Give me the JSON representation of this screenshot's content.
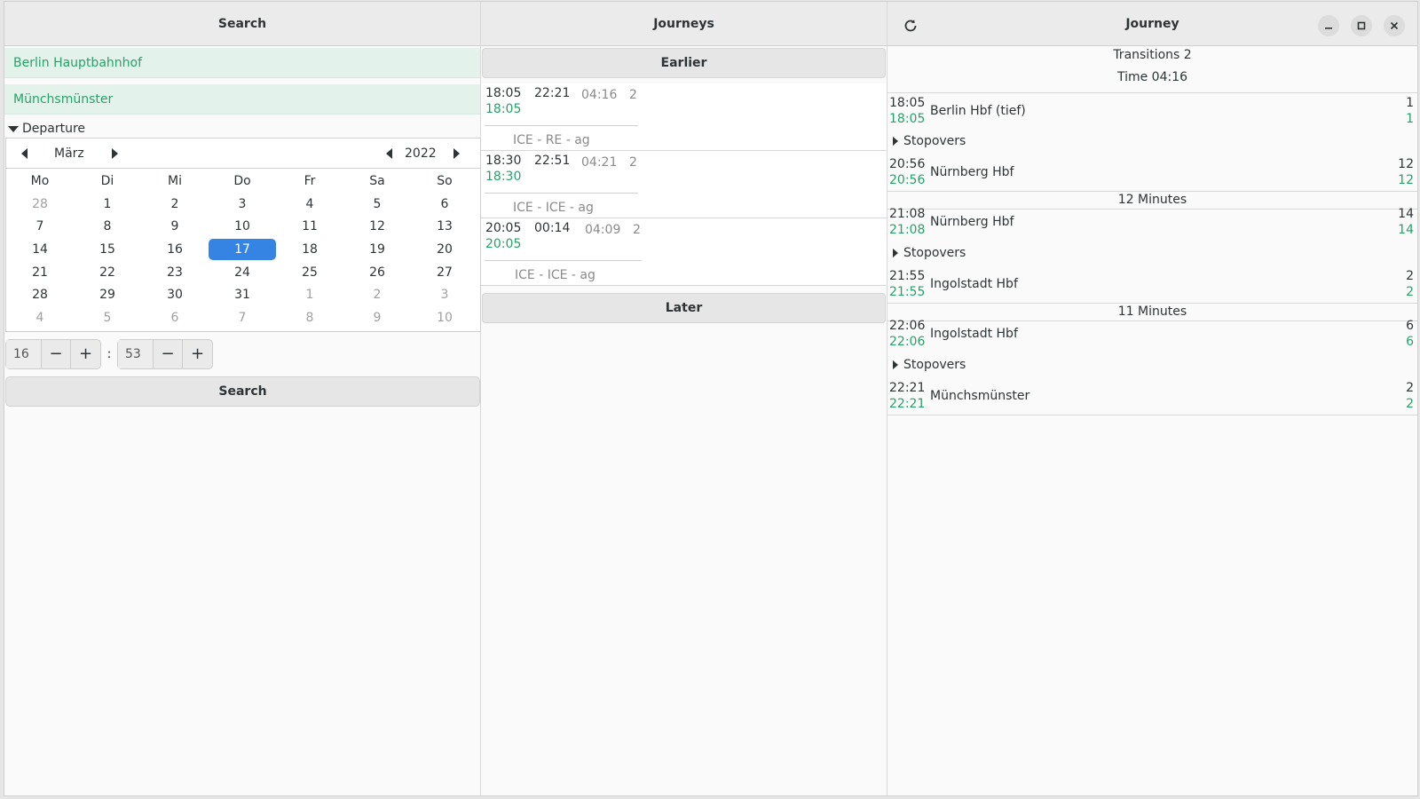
{
  "search": {
    "title": "Search",
    "from": "Berlin Hauptbahnhof",
    "to": "Münchsmünster",
    "mode": "Departure",
    "calendar": {
      "month": "März",
      "year": "2022",
      "weekdays": [
        "Mo",
        "Di",
        "Mi",
        "Do",
        "Fr",
        "Sa",
        "So"
      ],
      "weeks": [
        [
          "28",
          "1",
          "2",
          "3",
          "4",
          "5",
          "6"
        ],
        [
          "7",
          "8",
          "9",
          "10",
          "11",
          "12",
          "13"
        ],
        [
          "14",
          "15",
          "16",
          "17",
          "18",
          "19",
          "20"
        ],
        [
          "21",
          "22",
          "23",
          "24",
          "25",
          "26",
          "27"
        ],
        [
          "28",
          "29",
          "30",
          "31",
          "1",
          "2",
          "3"
        ],
        [
          "4",
          "5",
          "6",
          "7",
          "8",
          "9",
          "10"
        ]
      ],
      "selected_day": "17"
    },
    "hour": "16",
    "minute": "53",
    "colon": ":",
    "minus": "−",
    "plus": "+",
    "button": "Search"
  },
  "journeys": {
    "title": "Journeys",
    "earlier": "Earlier",
    "later": "Later",
    "items": [
      {
        "dep": "18:05",
        "dep_rt": "18:05",
        "arr": "22:21",
        "duration": "04:16",
        "transitions": "2",
        "trains": "ICE - RE - ag"
      },
      {
        "dep": "18:30",
        "dep_rt": "18:30",
        "arr": "22:51",
        "duration": "04:21",
        "transitions": "2",
        "trains": "ICE - ICE - ag"
      },
      {
        "dep": "20:05",
        "dep_rt": "20:05",
        "arr": "00:14",
        "duration": "04:09",
        "transitions": "2",
        "trains": "ICE - ICE - ag"
      }
    ]
  },
  "journey": {
    "title": "Journey",
    "transitions": "Transitions 2",
    "time": "Time 04:16",
    "stopovers_label": "Stopovers",
    "legs": [
      {
        "from": {
          "time": "18:05",
          "time_rt": "18:05",
          "name": "Berlin Hbf (tief)",
          "platform": "1",
          "platform_rt": "1"
        },
        "to": {
          "time": "20:56",
          "time_rt": "20:56",
          "name": "Nürnberg Hbf",
          "platform": "12",
          "platform_rt": "12"
        },
        "transfer": "12 Minutes"
      },
      {
        "from": {
          "time": "21:08",
          "time_rt": "21:08",
          "name": "Nürnberg Hbf",
          "platform": "14",
          "platform_rt": "14"
        },
        "to": {
          "time": "21:55",
          "time_rt": "21:55",
          "name": "Ingolstadt Hbf",
          "platform": "2",
          "platform_rt": "2"
        },
        "transfer": "11 Minutes"
      },
      {
        "from": {
          "time": "22:06",
          "time_rt": "22:06",
          "name": "Ingolstadt Hbf",
          "platform": "6",
          "platform_rt": "6"
        },
        "to": {
          "time": "22:21",
          "time_rt": "22:21",
          "name": "Münchsmünster",
          "platform": "2",
          "platform_rt": "2"
        }
      }
    ],
    "icons": {
      "refresh": "refresh-icon",
      "minimize": "minimize-icon",
      "maximize": "maximize-icon",
      "close": "close-icon"
    }
  },
  "colors": {
    "accent": "#3584e4",
    "realtime": "#26a269"
  }
}
